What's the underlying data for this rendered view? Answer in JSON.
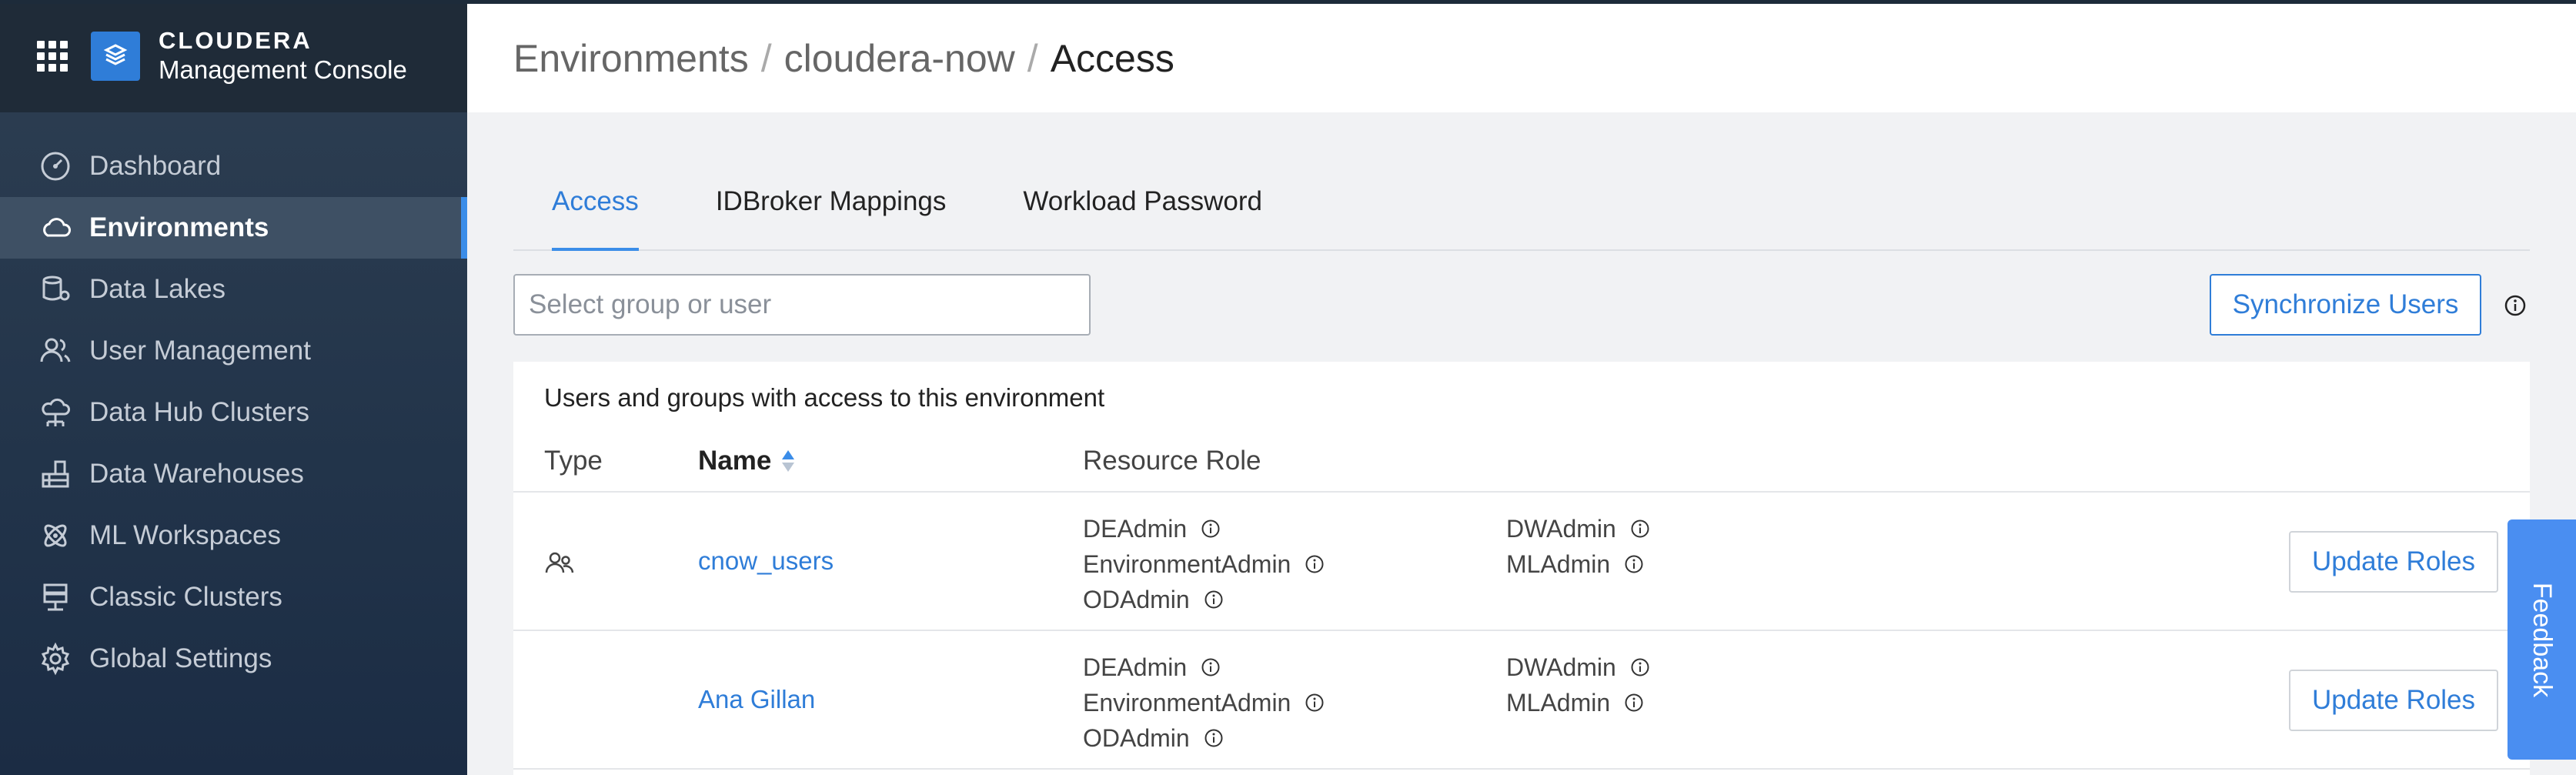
{
  "brand": {
    "line1": "CLOUDERA",
    "line2": "Management Console"
  },
  "nav": [
    {
      "label": "Dashboard",
      "icon": "dashboard-icon"
    },
    {
      "label": "Environments",
      "icon": "cloud-icon",
      "active": true
    },
    {
      "label": "Data Lakes",
      "icon": "data-lake-icon"
    },
    {
      "label": "User Management",
      "icon": "users-icon"
    },
    {
      "label": "Data Hub Clusters",
      "icon": "cloud-tree-icon"
    },
    {
      "label": "Data Warehouses",
      "icon": "warehouse-icon"
    },
    {
      "label": "ML Workspaces",
      "icon": "atom-icon"
    },
    {
      "label": "Classic Clusters",
      "icon": "server-icon"
    },
    {
      "label": "Global Settings",
      "icon": "gear-icon"
    }
  ],
  "breadcrumb": {
    "item1": "Environments",
    "item2": "cloudera-now",
    "current": "Access",
    "separator": "/"
  },
  "tabs": [
    {
      "label": "Access",
      "active": true
    },
    {
      "label": "IDBroker Mappings"
    },
    {
      "label": "Workload Password"
    }
  ],
  "search": {
    "placeholder": "Select group or user",
    "value": ""
  },
  "sync_button": "Synchronize Users",
  "card": {
    "title": "Users and groups with access to this environment",
    "columns": {
      "type": "Type",
      "name": "Name",
      "role": "Resource Role"
    }
  },
  "rows": [
    {
      "type_icon": "group-icon",
      "name": "cnow_users",
      "roles_left": [
        "DEAdmin",
        "EnvironmentAdmin",
        "ODAdmin"
      ],
      "roles_right": [
        "DWAdmin",
        "MLAdmin"
      ],
      "button": "Update Roles"
    },
    {
      "type_icon": "",
      "name": "Ana Gillan",
      "roles_left": [
        "DEAdmin",
        "EnvironmentAdmin",
        "ODAdmin"
      ],
      "roles_right": [
        "DWAdmin",
        "MLAdmin"
      ],
      "button": "Update Roles"
    }
  ],
  "feedback": "Feedback",
  "colors": {
    "accent": "#2f7dd8",
    "sidebar": "#22344a",
    "active_nav": "#3e5064"
  }
}
